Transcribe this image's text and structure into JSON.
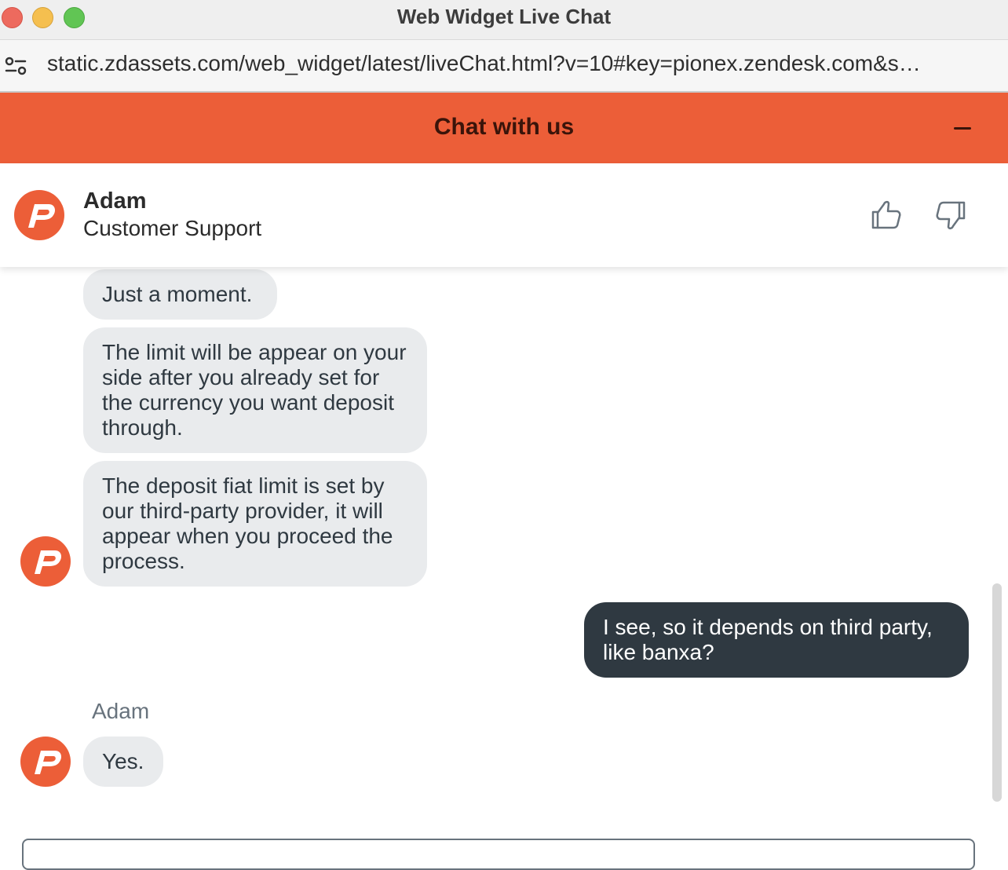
{
  "window": {
    "title": "Web Widget Live Chat"
  },
  "browser": {
    "url": "static.zdassets.com/web_widget/latest/liveChat.html?v=10#key=pionex.zendesk.com&s…"
  },
  "widget": {
    "header_title": "Chat with us",
    "minimize_icon": "minus-icon",
    "accent_color": "#ec5e38"
  },
  "agent": {
    "name": "Adam",
    "role": "Customer Support",
    "rate_good_icon": "thumbs-up-icon",
    "rate_bad_icon": "thumbs-down-icon"
  },
  "messages": [
    {
      "from": "agent",
      "text": "Just a moment."
    },
    {
      "from": "agent",
      "text": "The limit will be appear on your side after you already set for the currency you want deposit through."
    },
    {
      "from": "agent",
      "text": "The deposit fiat limit is set by our third-party provider, it will appear when you proceed the process."
    },
    {
      "from": "user",
      "text": "I see, so it depends on third party, like banxa?"
    },
    {
      "from": "agent",
      "sender": "Adam",
      "text": "Yes."
    }
  ]
}
